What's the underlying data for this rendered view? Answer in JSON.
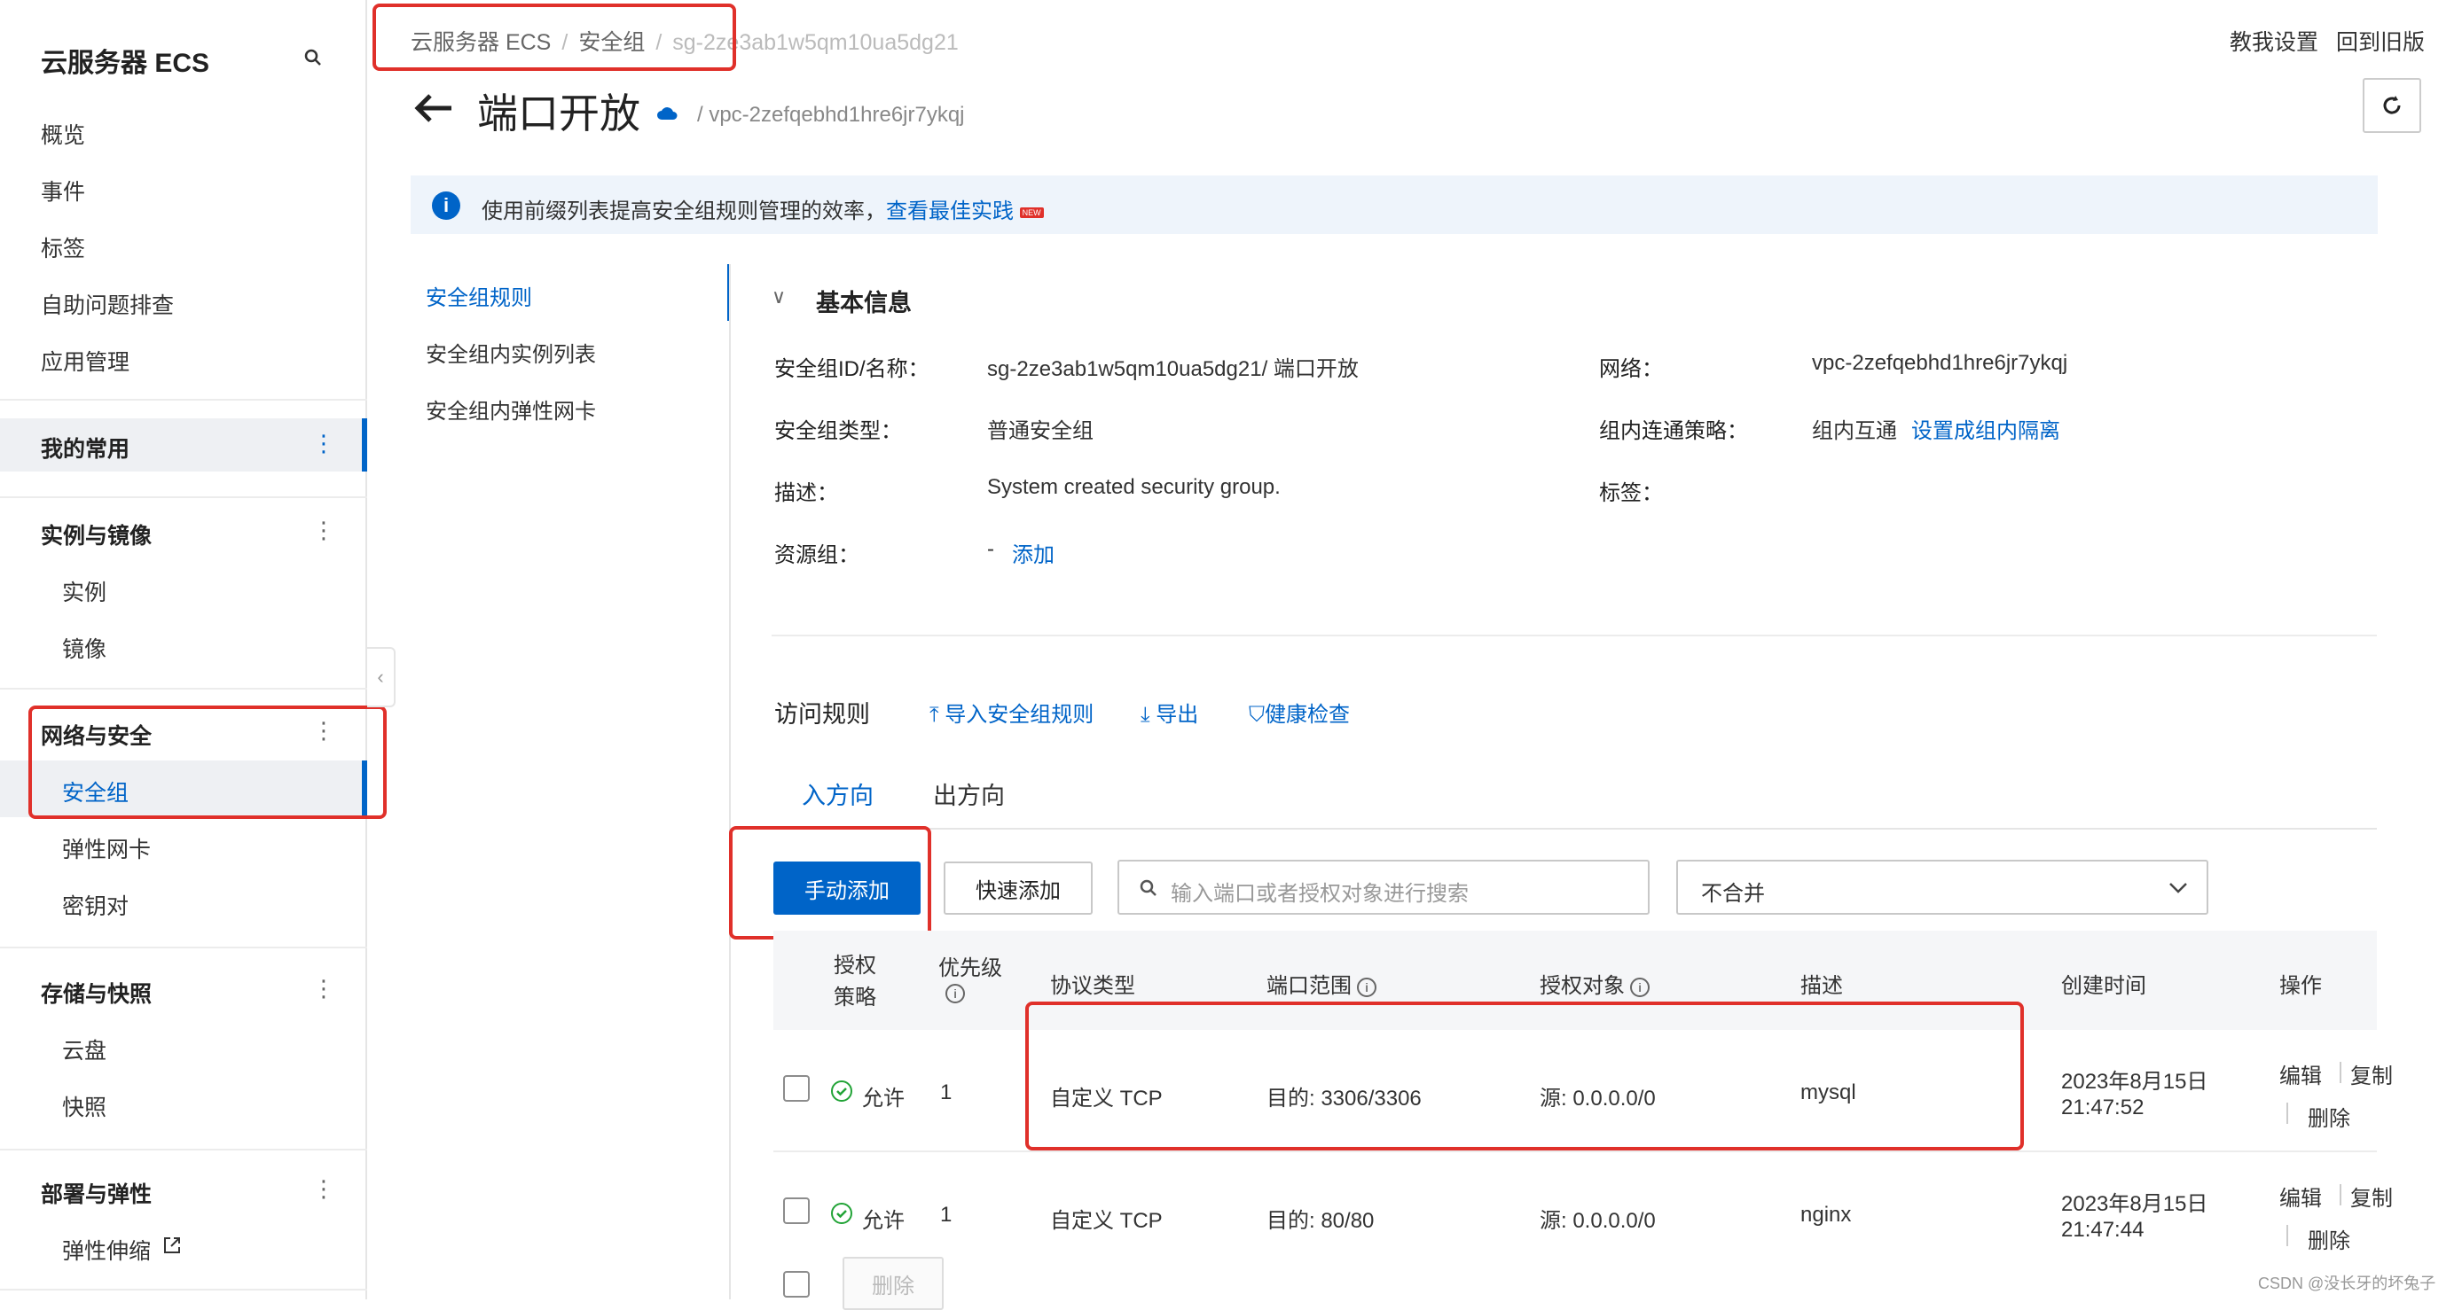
{
  "sidebar": {
    "title": "云服务器 ECS",
    "top_items": [
      "概览",
      "事件",
      "标签",
      "自助问题排查",
      "应用管理"
    ],
    "my_common": "我的常用",
    "group_instances": "实例与镜像",
    "instances_items": [
      "实例",
      "镜像"
    ],
    "group_network": "网络与安全",
    "network_items": [
      "安全组",
      "弹性网卡",
      "密钥对"
    ],
    "group_storage": "存储与快照",
    "storage_items": [
      "云盘",
      "快照"
    ],
    "group_deploy": "部署与弹性",
    "deploy_items": [
      "弹性伸缩"
    ]
  },
  "breadcrumb": {
    "a": "云服务器 ECS",
    "b": "安全组",
    "c": "sg-2ze3ab1w5qm10ua5dg21"
  },
  "top_links": {
    "tutorial": "教我设置",
    "old": "回到旧版"
  },
  "page": {
    "title": "端口开放",
    "vpc": "/ vpc-2zefqebhd1hre6jr7ykqj"
  },
  "banner": {
    "text": "使用前缀列表提高安全组规则管理的效率，",
    "link": "查看最佳实践",
    "badge": "NEW"
  },
  "left_tabs": [
    "安全组规则",
    "安全组内实例列表",
    "安全组内弹性网卡"
  ],
  "basic": {
    "header": "基本信息",
    "id_label": "安全组ID/名称：",
    "id_value": "sg-2ze3ab1w5qm10ua5dg21/ 端口开放",
    "type_label": "安全组类型：",
    "type_value": "普通安全组",
    "desc_label": "描述：",
    "desc_value": "System created security group.",
    "rg_label": "资源组：",
    "rg_dash": "-",
    "rg_add": "添加",
    "net_label": "网络：",
    "net_value": "vpc-2zefqebhd1hre6jr7ykqj",
    "policy_label": "组内连通策略：",
    "policy_value": "组内互通",
    "policy_link": "设置成组内隔离",
    "tag_label": "标签："
  },
  "rules": {
    "header": "访问规则",
    "import": "导入安全组规则",
    "export": "导出",
    "health": "健康检查",
    "tab_in": "入方向",
    "tab_out": "出方向",
    "btn_manual": "手动添加",
    "btn_quick": "快速添加",
    "search_placeholder": "输入端口或者授权对象进行搜索",
    "select_value": "不合并",
    "delete_btn": "删除"
  },
  "table": {
    "headers": {
      "policy": "授权策略",
      "priority": "优先级",
      "protocol": "协议类型",
      "port": "端口范围",
      "source": "授权对象",
      "desc": "描述",
      "created": "创建时间",
      "ops": "操作"
    },
    "rows": [
      {
        "policy": "允许",
        "priority": "1",
        "protocol": "自定义 TCP",
        "port": "目的: 3306/3306",
        "source": "源: 0.0.0.0/0",
        "desc": "mysql",
        "date": "2023年8月15日",
        "time": "21:47:52",
        "edit": "编辑",
        "copy": "复制",
        "del": "删除"
      },
      {
        "policy": "允许",
        "priority": "1",
        "protocol": "自定义 TCP",
        "port": "目的: 80/80",
        "source": "源: 0.0.0.0/0",
        "desc": "nginx",
        "date": "2023年8月15日",
        "time": "21:47:44",
        "edit": "编辑",
        "copy": "复制",
        "del": "删除"
      }
    ]
  },
  "watermark": "CSDN @没长牙的坏兔子"
}
